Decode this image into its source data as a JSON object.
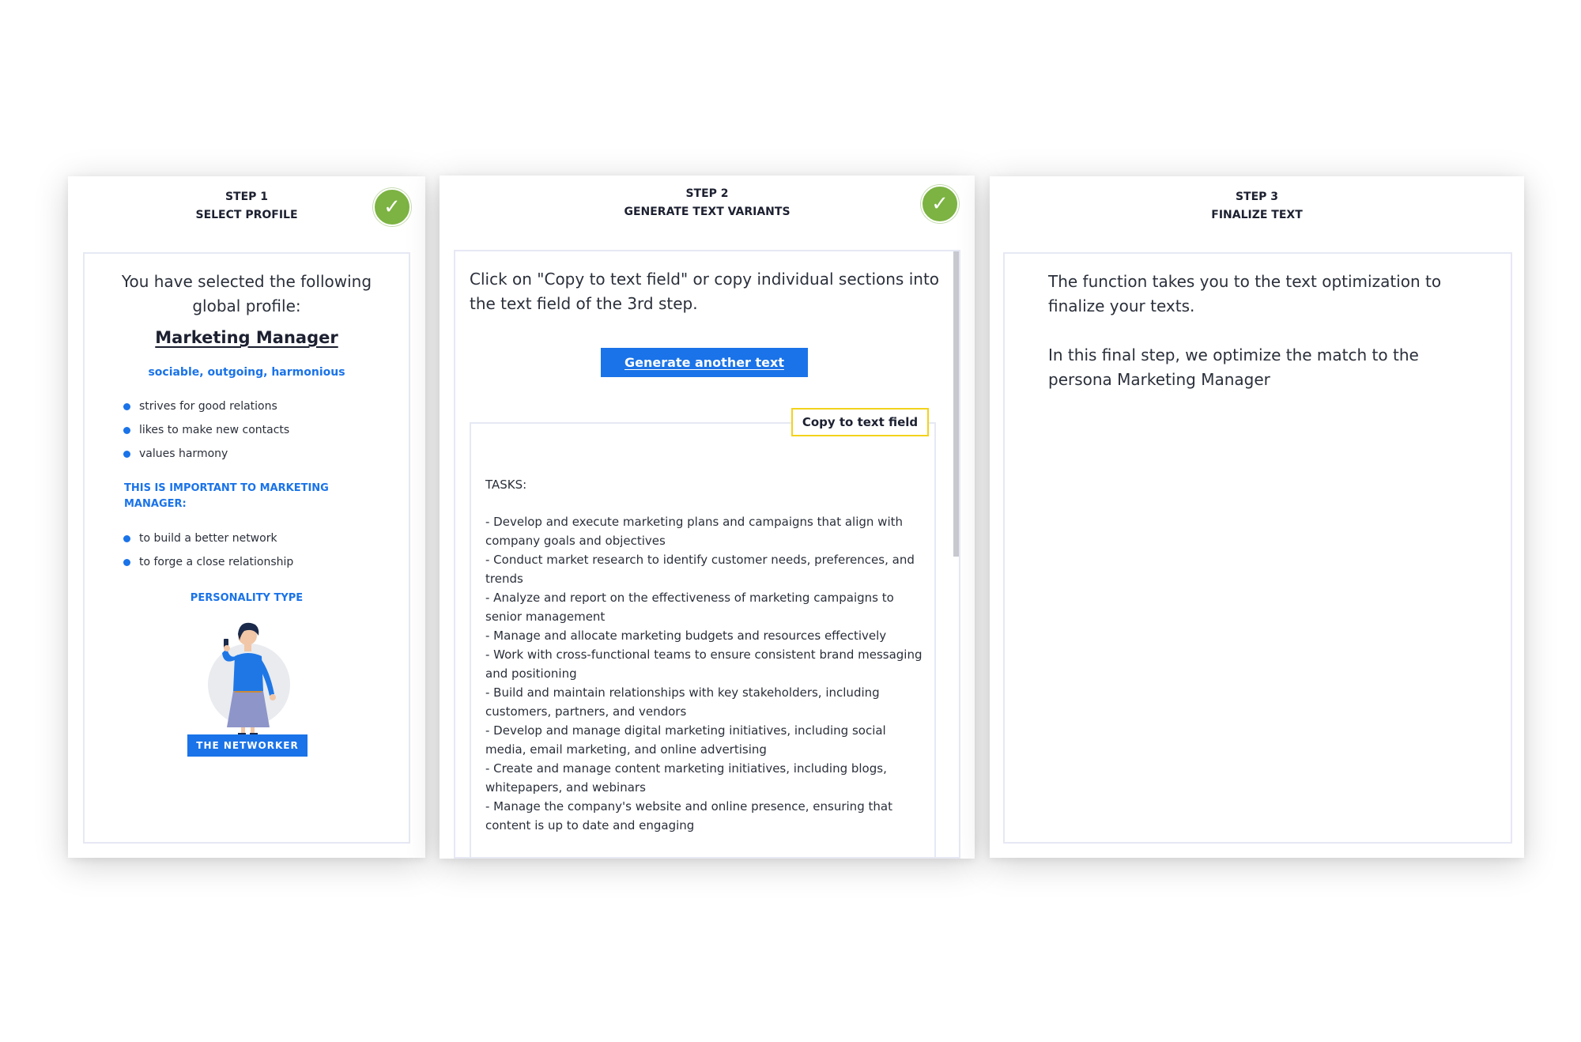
{
  "steps": [
    {
      "line1": "STEP 1",
      "line2": "SELECT PROFILE"
    },
    {
      "line1": "STEP 2",
      "line2": "GENERATE TEXT VARIANTS"
    },
    {
      "line1": "STEP 3",
      "line2": "FINALIZE TEXT"
    }
  ],
  "checkmark": "✓",
  "step1": {
    "intro": "You have selected the following global profile:",
    "profile_name": "Marketing Manager",
    "traits": "sociable, outgoing, harmonious",
    "bullets": [
      "strives for good relations",
      "likes to make new contacts",
      "values harmony"
    ],
    "important_heading": "THIS IS IMPORTANT TO MARKETING MANAGER:",
    "important_bullets": [
      "to build a better network",
      "to forge a close relationship"
    ],
    "personality_heading": "PERSONALITY TYPE",
    "personality_badge": "THE NETWORKER"
  },
  "step2": {
    "intro": "Click on \"Copy to text field\" or copy individual sections into the text field of the 3rd step.",
    "generate_button": "Generate another text",
    "copy_button": "Copy to text field",
    "tasks_label": "TASKS:",
    "tasks": [
      "- Develop and execute marketing plans and campaigns that align with company goals and objectives",
      "- Conduct market research to identify customer needs, preferences, and trends",
      "- Analyze and report on the effectiveness of marketing campaigns to senior management",
      "- Manage and allocate marketing budgets and resources effectively",
      "- Work with cross-functional teams to ensure consistent brand messaging and positioning",
      "- Build and maintain relationships with key stakeholders, including customers, partners, and vendors",
      "- Develop and manage digital marketing initiatives, including social media, email marketing, and online advertising",
      "- Create and manage content marketing initiatives, including blogs, whitepapers, and webinars",
      "- Manage the company's website and online presence, ensuring that content is up to date and engaging"
    ]
  },
  "step3": {
    "paragraph1": "The function takes you to the text optimization to finalize your texts.",
    "paragraph2": "In this final step, we optimize the match to the persona Marketing Manager"
  },
  "colors": {
    "accent_blue": "#1a73e8",
    "check_green": "#7cb342",
    "copy_border_yellow": "#f2d21c"
  },
  "icons": [
    "check-icon",
    "check-icon",
    "bullet-icon"
  ]
}
